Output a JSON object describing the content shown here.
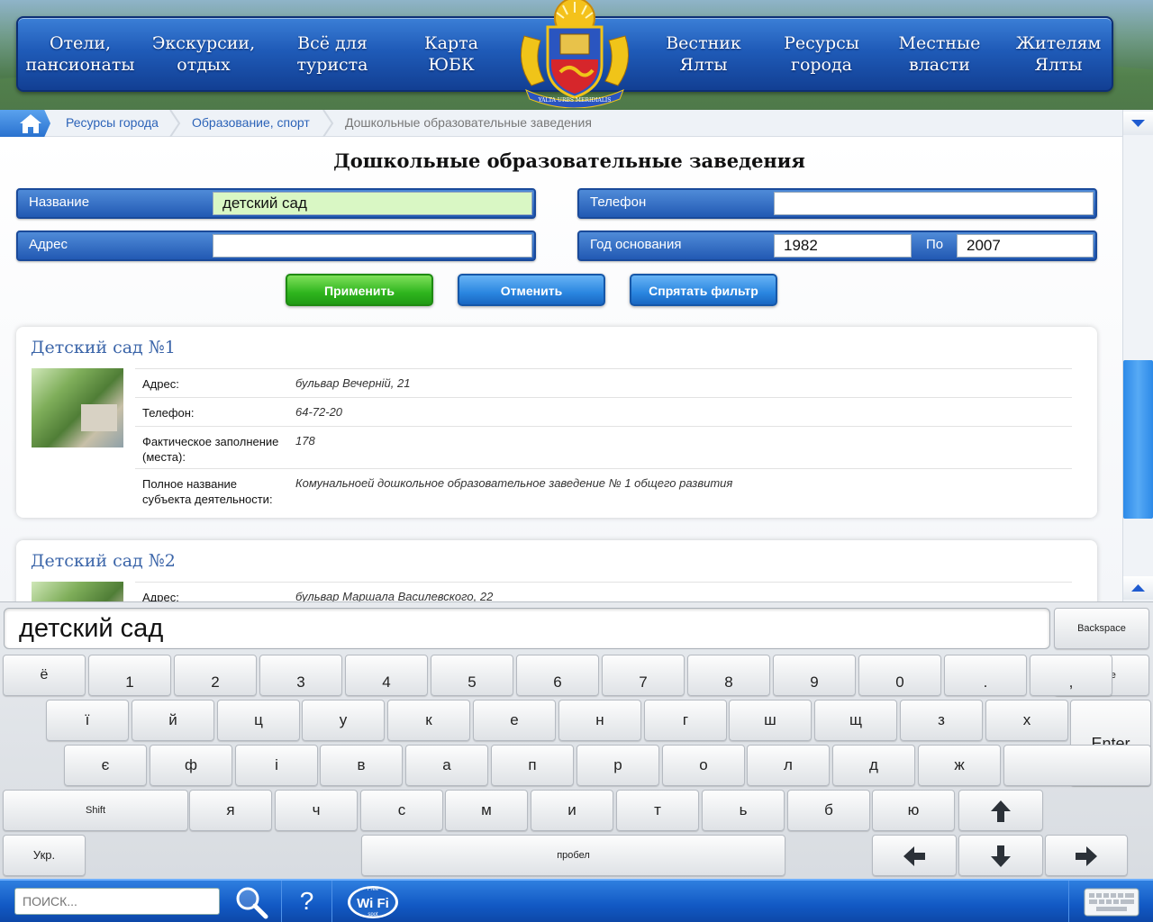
{
  "nav": {
    "items": [
      {
        "line1": "Отели,",
        "line2": "пансионаты"
      },
      {
        "line1": "Экскурсии,",
        "line2": "отдых"
      },
      {
        "line1": "Всё для",
        "line2": "туриста"
      },
      {
        "line1": "Карта",
        "line2": "ЮБК"
      },
      {
        "line1": "Вестник",
        "line2": "Ялты"
      },
      {
        "line1": "Ресурсы",
        "line2": "города"
      },
      {
        "line1": "Местные",
        "line2": "власти"
      },
      {
        "line1": "Жителям",
        "line2": "Ялты"
      }
    ],
    "emblem_motto": "YALTA URBS MERIDIALIS"
  },
  "breadcrumb": {
    "items": [
      "Ресурсы города",
      "Образование, спорт",
      "Дошкольные образовательные заведения"
    ]
  },
  "page": {
    "title": "Дошкольные образовательные заведения"
  },
  "filters": {
    "name": {
      "label": "Название",
      "value": "детский сад"
    },
    "address": {
      "label": "Адрес",
      "value": ""
    },
    "phone": {
      "label": "Телефон",
      "value": ""
    },
    "year": {
      "label": "Год основания",
      "from": "1982",
      "to_label": "По",
      "to": "2007"
    }
  },
  "buttons": {
    "apply": "Применить",
    "cancel": "Отменить",
    "hide_filter": "Спрятать фильтр"
  },
  "results": [
    {
      "title": "Детский сад №1",
      "rows": [
        {
          "label": "Адрес:",
          "value": "бульвар Вечерній, 21"
        },
        {
          "label": "Телефон:",
          "value": "64-72-20"
        },
        {
          "label": "Фактическое заполнение (места):",
          "value": "178"
        },
        {
          "label": "Полное название субъекта деятельности:",
          "value": "Комунальноей дошкольное образовательное заведение № 1 общего развития"
        }
      ]
    },
    {
      "title": "Детский сад №2",
      "rows": [
        {
          "label": "Адрес:",
          "value": "бульвар Маршала Василевского, 22"
        }
      ]
    }
  ],
  "keyboard": {
    "input_value": "детский сад",
    "row_numbers": [
      "ё",
      "1",
      "2",
      "3",
      "4",
      "5",
      "6",
      "7",
      "8",
      "9",
      "0",
      ".",
      ","
    ],
    "row1": [
      "ї",
      "й",
      "ц",
      "у",
      "к",
      "е",
      "н",
      "г",
      "ш",
      "щ",
      "з",
      "х"
    ],
    "row2": [
      "є",
      "ф",
      "і",
      "в",
      "а",
      "п",
      "р",
      "о",
      "л",
      "д",
      "ж"
    ],
    "row3": [
      "я",
      "ч",
      "с",
      "м",
      "и",
      "т",
      "ь",
      "б",
      "ю"
    ],
    "backspace": "Backspace",
    "delete": "Delete",
    "enter": "Enter",
    "shift": "Shift",
    "lang": "Укр.",
    "space": "пробел"
  },
  "footer": {
    "search_placeholder": "ПОИСК...",
    "help_label": "?",
    "wifi_label": "Wi Fi",
    "wifi_free": "Free",
    "wifi_spot": "spot"
  },
  "colors": {
    "nav_blue": "#1f5bb8",
    "apply_green": "#2fb51e",
    "action_blue": "#2a86e0",
    "active_field": "#d9f7c4",
    "footer_blue": "#1259c4"
  }
}
